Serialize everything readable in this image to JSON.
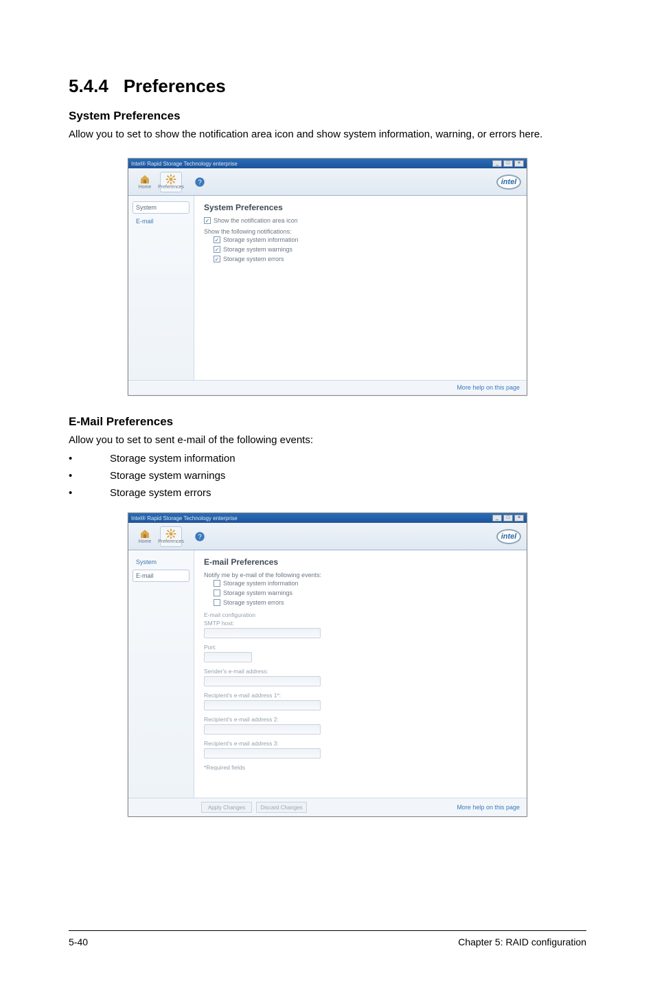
{
  "heading": {
    "number": "5.4.4",
    "title": "Preferences"
  },
  "sys_pref": {
    "title": "System Preferences",
    "desc": "Allow you to set to show the notification area icon and show system information, warning, or errors here."
  },
  "window1": {
    "titlebar": "Intel® Rapid Storage Technology enterprise",
    "winctrls": {
      "min": "_",
      "max": "□",
      "close": "×"
    },
    "tabs": {
      "home": "Home",
      "preferences": "Preferences",
      "help": "?"
    },
    "logo": "intel",
    "sidebar": {
      "system": "System",
      "email": "E-mail"
    },
    "panel_title": "System Preferences",
    "row1": "Show the notification area icon",
    "row2_intro": "Show the following notifications:",
    "row2a": "Storage system information",
    "row2b": "Storage system warnings",
    "row2c": "Storage system errors",
    "more": "More help on this page"
  },
  "email_pref": {
    "title": "E-Mail Preferences",
    "desc": "Allow you to set to sent e-mail of the following events:",
    "bullets": [
      "Storage system information",
      "Storage system warnings",
      "Storage system errors"
    ]
  },
  "window2": {
    "titlebar": "Intel® Rapid Storage Technology enterprise",
    "sidebar": {
      "system": "System",
      "email": "E-mail"
    },
    "panel_title": "E-mail Preferences",
    "intro": "Notify me by e-mail of the following events:",
    "opts": [
      "Storage system information",
      "Storage system warnings",
      "Storage system errors"
    ],
    "grp1": "E-mail configuration",
    "f1": "SMTP host:",
    "f2": "Port:",
    "f3": "Sender's e-mail address:",
    "f4": "Recipient's e-mail address 1*:",
    "f5": "Recipient's e-mail address 2:",
    "f6": "Recipient's e-mail address 3:",
    "req": "*Required fields",
    "btn_apply": "Apply Changes",
    "btn_discard": "Discard Changes",
    "more": "More help on this page"
  },
  "footer": {
    "left": "5-40",
    "right": "Chapter 5: RAID configuration"
  }
}
